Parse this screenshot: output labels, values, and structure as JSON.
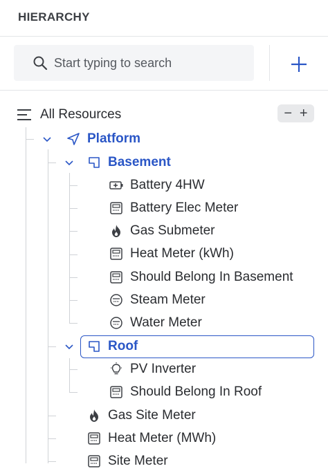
{
  "header": {
    "title": "HIERARCHY"
  },
  "search": {
    "placeholder": "Start typing to search",
    "value": ""
  },
  "toolbar": {
    "add_symbol": "+",
    "collapse_symbol": "−",
    "expand_symbol": "+"
  },
  "tree": {
    "root": {
      "label": "All Resources"
    },
    "platform": {
      "label": "Platform"
    },
    "basement": {
      "label": "Basement",
      "items": [
        {
          "label": "Battery 4HW",
          "icon": "battery-icon"
        },
        {
          "label": "Battery Elec Meter",
          "icon": "meter-icon"
        },
        {
          "label": "Gas Submeter",
          "icon": "flame-icon"
        },
        {
          "label": "Heat Meter (kWh)",
          "icon": "meter-icon"
        },
        {
          "label": "Should Belong In Basement",
          "icon": "meter-icon"
        },
        {
          "label": "Steam Meter",
          "icon": "gauge-icon"
        },
        {
          "label": "Water Meter",
          "icon": "gauge-icon"
        }
      ]
    },
    "roof": {
      "label": "Roof",
      "items": [
        {
          "label": "PV Inverter",
          "icon": "bulb-icon"
        },
        {
          "label": "Should Belong In Roof",
          "icon": "meter-icon"
        }
      ]
    },
    "platform_items": [
      {
        "label": "Gas Site Meter",
        "icon": "flame-icon"
      },
      {
        "label": "Heat Meter (MWh)",
        "icon": "meter-icon"
      },
      {
        "label": "Site Meter",
        "icon": "meter-icon"
      }
    ]
  },
  "colors": {
    "accent": "#2a56c6",
    "text": "#2a2c30",
    "line": "#cfd2d6"
  }
}
